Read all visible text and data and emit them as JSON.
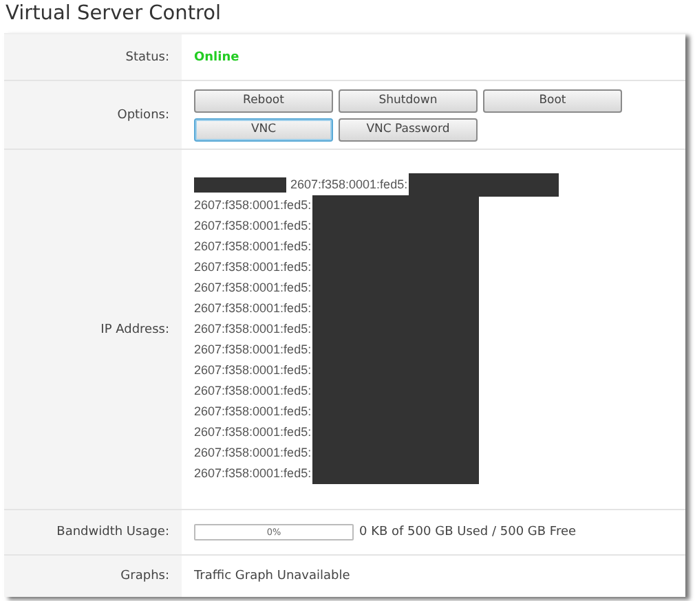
{
  "title": "Virtual Server Control",
  "status": {
    "label": "Status:",
    "value": "Online"
  },
  "options": {
    "label": "Options:",
    "buttons": [
      {
        "label": "Reboot",
        "focused": false
      },
      {
        "label": "Shutdown",
        "focused": false
      },
      {
        "label": "Boot",
        "focused": false
      },
      {
        "label": "VNC",
        "focused": true
      },
      {
        "label": "VNC Password",
        "focused": false
      }
    ]
  },
  "ip_address": {
    "label": "IP Address:",
    "addresses": [
      {
        "text": "2607:f358:0001:fed5:",
        "redacted_before": true
      },
      {
        "text": "2607:f358:0001:fed5:",
        "redacted_before": false
      },
      {
        "text": "2607:f358:0001:fed5:",
        "redacted_before": false
      },
      {
        "text": "2607:f358:0001:fed5:",
        "redacted_before": false
      },
      {
        "text": "2607:f358:0001:fed5:",
        "redacted_before": false
      },
      {
        "text": "2607:f358:0001:fed5:",
        "redacted_before": false
      },
      {
        "text": "2607:f358:0001:fed5:",
        "redacted_before": false
      },
      {
        "text": "2607:f358:0001:fed5:",
        "redacted_before": false
      },
      {
        "text": "2607:f358:0001:fed5:",
        "redacted_before": false
      },
      {
        "text": "2607:f358:0001:fed5:",
        "redacted_before": false
      },
      {
        "text": "2607:f358:0001:fed5:",
        "redacted_before": false
      },
      {
        "text": "2607:f358:0001:fed5:",
        "redacted_before": false
      },
      {
        "text": "2607:f358:0001:fed5:",
        "redacted_before": false
      },
      {
        "text": "2607:f358:0001:fed5:",
        "redacted_before": false
      },
      {
        "text": "2607:f358:0001:fed5:",
        "redacted_before": false
      }
    ]
  },
  "bandwidth": {
    "label": "Bandwidth Usage:",
    "level": 0,
    "percent": "0%",
    "summary": "0 KB of 500 GB Used / 500 GB Free"
  },
  "graphs": {
    "label": "Graphs:",
    "value": "Traffic Graph Unavailable"
  }
}
